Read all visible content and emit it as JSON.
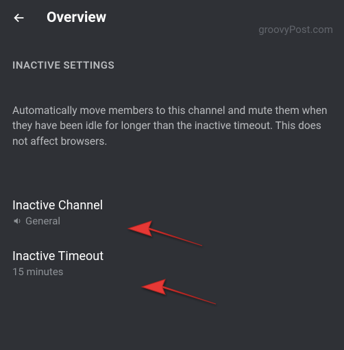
{
  "header": {
    "title": "Overview"
  },
  "watermark": "groovyPost.com",
  "section": {
    "header": "INACTIVE SETTINGS",
    "description": "Automatically move members to this channel and mute them when they have been idle for longer than the inactive timeout. This does not affect browsers."
  },
  "settings": {
    "inactive_channel": {
      "label": "Inactive Channel",
      "value": "General"
    },
    "inactive_timeout": {
      "label": "Inactive Timeout",
      "value": "15 minutes"
    }
  }
}
